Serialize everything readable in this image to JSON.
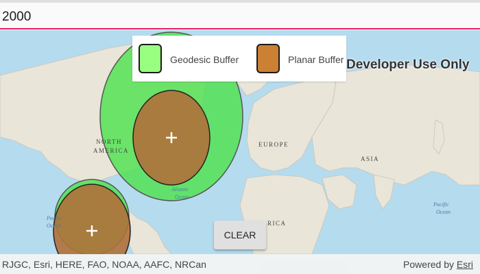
{
  "input": {
    "value": "2000"
  },
  "legend": {
    "geodesic": {
      "label": "Geodesic Buffer",
      "color": "#99ff80"
    },
    "planar": {
      "label": "Planar Buffer",
      "color": "#cc8033"
    }
  },
  "watermark": "Developer Use Only",
  "clear_button": "CLEAR",
  "attribution": {
    "text": "RJGC, Esri, HERE, FAO, NOAA, AAFC, NRCan",
    "powered_by": "Powered by",
    "esri": "Esri"
  },
  "map_labels": {
    "north": "NORTH",
    "america": "AMERICA",
    "europe": "EUROPE",
    "asia": "ASIA",
    "atlantic": "Atlantic",
    "ocean": "Ocean",
    "pacific": "Pacific",
    "africa": "RICA"
  },
  "colors": {
    "accent": "#e91e63",
    "land": "#e8e4d8",
    "water": "#b5dbee",
    "geodesic_fill": "#4fe04f",
    "planar_fill": "#b0703a"
  }
}
